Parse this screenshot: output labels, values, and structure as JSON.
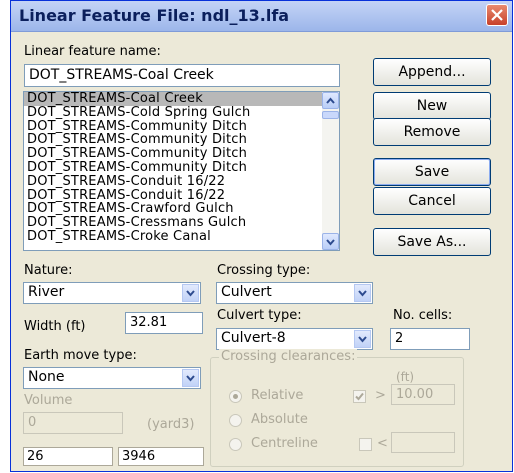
{
  "window": {
    "title": "Linear Feature File:  ndl_13.lfa",
    "close_icon": "close-icon"
  },
  "name_label": "Linear feature name:",
  "name_value": "DOT_STREAMS-Coal Creek",
  "list_items": [
    "DOT_STREAMS-Coal Creek",
    "DOT_STREAMS-Cold Spring Gulch",
    "DOT_STREAMS-Community Ditch",
    "DOT_STREAMS-Community Ditch",
    "DOT_STREAMS-Community Ditch",
    "DOT_STREAMS-Community Ditch",
    "DOT_STREAMS-Conduit 16/22",
    "DOT_STREAMS-Conduit 16/22",
    "DOT_STREAMS-Crawford Gulch",
    "DOT_STREAMS-Cressmans Gulch",
    "DOT_STREAMS-Croke Canal"
  ],
  "buttons": {
    "append": "Append...",
    "new": "New",
    "remove": "Remove",
    "save": "Save",
    "cancel": "Cancel",
    "save_as": "Save As..."
  },
  "nature": {
    "label": "Nature:",
    "value": "River"
  },
  "crossing_type": {
    "label": "Crossing type:",
    "value": "Culvert"
  },
  "width": {
    "label": "Width (ft)",
    "value": "32.81"
  },
  "culvert_type": {
    "label": "Culvert type:",
    "value": "Culvert-8"
  },
  "no_cells": {
    "label": "No. cells:",
    "value": "2"
  },
  "earth_move_type": {
    "label": "Earth move type:",
    "value": "None"
  },
  "volume": {
    "label": "Volume",
    "value": "0",
    "unit": "(yard3)"
  },
  "crossing_clearances": {
    "title": "Crossing clearances:",
    "unit": "(ft)",
    "relative": "Relative",
    "absolute": "Absolute",
    "centreline": "Centreline",
    "gt": ">",
    "lt": "<",
    "relative_value": "10.00",
    "centreline_value": ""
  },
  "status": {
    "left": "26",
    "right": "3946"
  }
}
